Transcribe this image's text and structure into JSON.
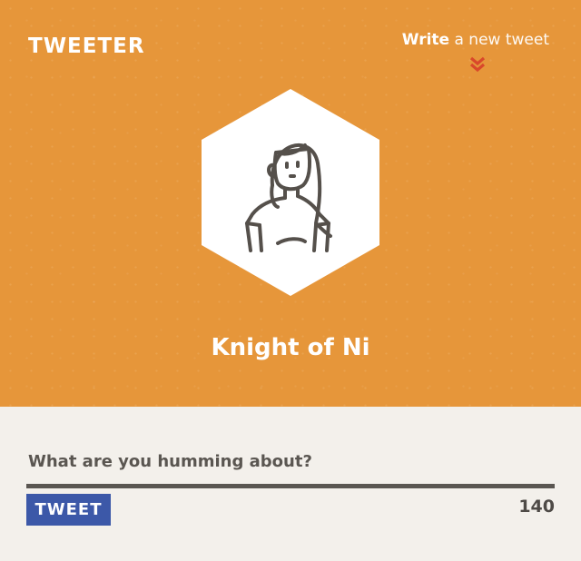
{
  "header": {
    "logo": "TWEETER",
    "write_link": {
      "strong": "Write",
      "rest": " a new tweet"
    },
    "chevron_icon": "double-chevron-down-icon"
  },
  "profile": {
    "avatar_icon": "person-avatar-icon",
    "name": "Knight of Ni"
  },
  "composer": {
    "placeholder": "What are you humming about?",
    "value": "",
    "button_label": "TWEET",
    "char_count": "140"
  },
  "colors": {
    "header_bg": "#e6963a",
    "composer_bg": "#f3f0eb",
    "accent_red": "#d9482b",
    "button_blue": "#3c58a8",
    "text_dark": "#5a5651"
  }
}
